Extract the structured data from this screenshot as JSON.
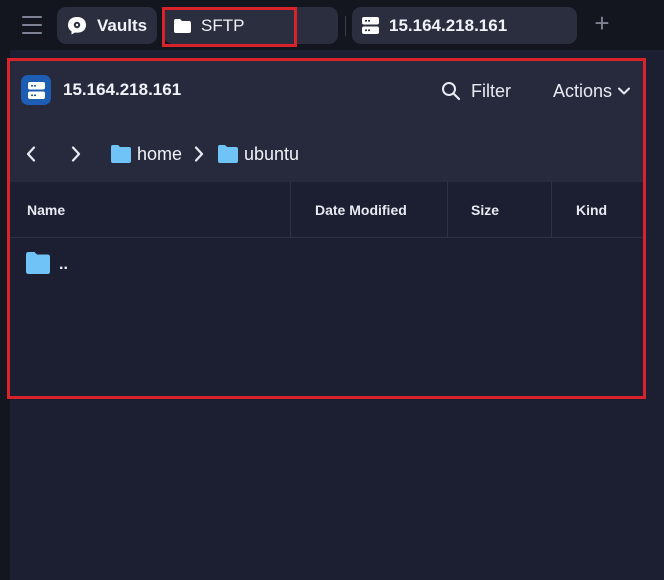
{
  "tabbar": {
    "menu_icon": "hamburger-menu-icon",
    "tabs": [
      {
        "label": "Vaults",
        "icon": "vault-icon"
      },
      {
        "label": "SFTP",
        "icon": "folder-icon"
      },
      {
        "label": "15.164.218.161",
        "icon": "server-icon"
      }
    ],
    "new_tab_icon": "plus-icon",
    "new_tab_glyph": "+"
  },
  "panel": {
    "server_title": "15.164.218.161",
    "server_icon": "server-icon",
    "filter_label": "Filter",
    "actions_label": "Actions",
    "breadcrumb": [
      {
        "label": "home",
        "icon": "folder-icon"
      },
      {
        "label": "ubuntu",
        "icon": "folder-icon"
      }
    ],
    "columns": [
      "Name",
      "Date Modified",
      "Size",
      "Kind"
    ],
    "rows": [
      {
        "name": "..",
        "icon": "folder-icon"
      }
    ]
  },
  "colors": {
    "accent": "#1d5db3",
    "folder": "#6fc3f7",
    "highlight": "#d9222a",
    "background": "#1c1f31"
  }
}
